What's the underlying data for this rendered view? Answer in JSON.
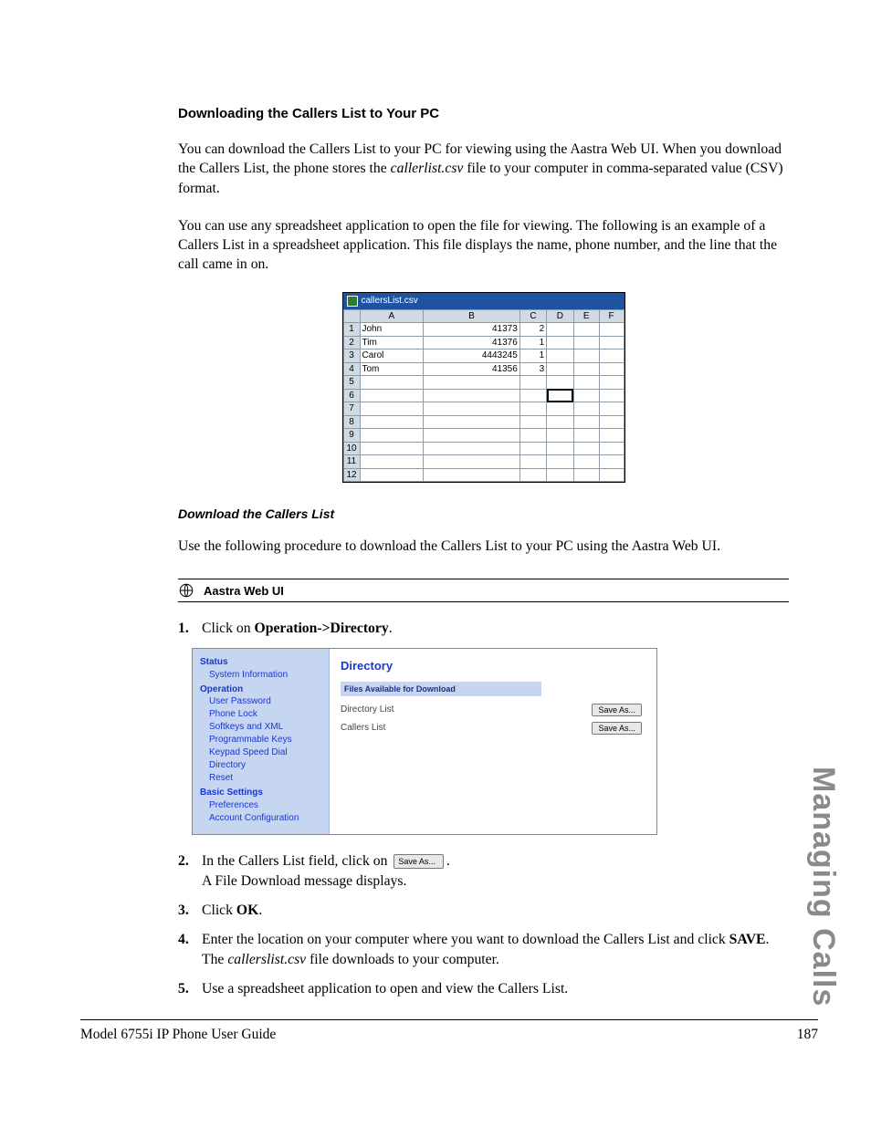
{
  "headings": {
    "h1": "Downloading the Callers List to Your PC",
    "h2": "Download the Callers List"
  },
  "paragraphs": {
    "p1a": "You can download the Callers List to your PC for viewing using the Aastra Web UI. When you download the Callers List, the phone stores the ",
    "p1b": "callerlist.csv",
    "p1c": " file to your computer in comma-separated value (CSV) format.",
    "p2": "You can use any spreadsheet application to open the file for viewing. The following is an example of a Callers List in a spreadsheet application. This file displays the name, phone number, and the line that the call came in on.",
    "p3": "Use the following procedure to download the Callers List to your PC using the Aastra Web UI."
  },
  "spreadsheet": {
    "filename": "callersList.csv",
    "cols": [
      "A",
      "B",
      "C",
      "D",
      "E",
      "F"
    ],
    "rows": [
      {
        "n": "1",
        "a": "John",
        "b": "41373",
        "c": "2"
      },
      {
        "n": "2",
        "a": "Tim",
        "b": "41376",
        "c": "1"
      },
      {
        "n": "3",
        "a": "Carol",
        "b": "4443245",
        "c": "1"
      },
      {
        "n": "4",
        "a": "Tom",
        "b": "41356",
        "c": "3"
      },
      {
        "n": "5"
      },
      {
        "n": "6"
      },
      {
        "n": "7"
      },
      {
        "n": "8"
      },
      {
        "n": "9"
      },
      {
        "n": "10"
      },
      {
        "n": "11"
      },
      {
        "n": "12"
      }
    ]
  },
  "webui_bar": "Aastra Web UI",
  "steps": {
    "s1a": "Click on ",
    "s1b": "Operation->Directory",
    "s1c": ".",
    "s2a": "In the Callers List field, click on ",
    "s2b": ".",
    "s2c": "A File Download message displays.",
    "s3a": "Click ",
    "s3b": "OK",
    "s3c": ".",
    "s4a": "Enter the location on your computer where you want to download the Callers List and click ",
    "s4b": "SAVE",
    "s4c": ".",
    "s4d": "The ",
    "s4e": "callerslist.csv",
    "s4f": " file downloads to your computer.",
    "s5": "Use a spreadsheet application to open and view the Callers List."
  },
  "panel": {
    "title": "Directory",
    "section": "Files Available for Download",
    "nav_headers": {
      "status": "Status",
      "operation": "Operation",
      "basic": "Basic Settings"
    },
    "nav": {
      "sysinfo": "System Information",
      "userpw": "User Password",
      "phonelock": "Phone Lock",
      "softkeys": "Softkeys and XML",
      "progkeys": "Programmable Keys",
      "speeddial": "Keypad Speed Dial",
      "directory": "Directory",
      "reset": "Reset",
      "prefs": "Preferences",
      "acct": "Account Configuration"
    },
    "rows": {
      "dirlist": "Directory List",
      "callers": "Callers List",
      "btn": "Save As..."
    }
  },
  "inline_btn": "Save As...",
  "side_tab": "Managing Calls",
  "footer": {
    "left": "Model 6755i IP Phone User Guide",
    "right": "187"
  }
}
